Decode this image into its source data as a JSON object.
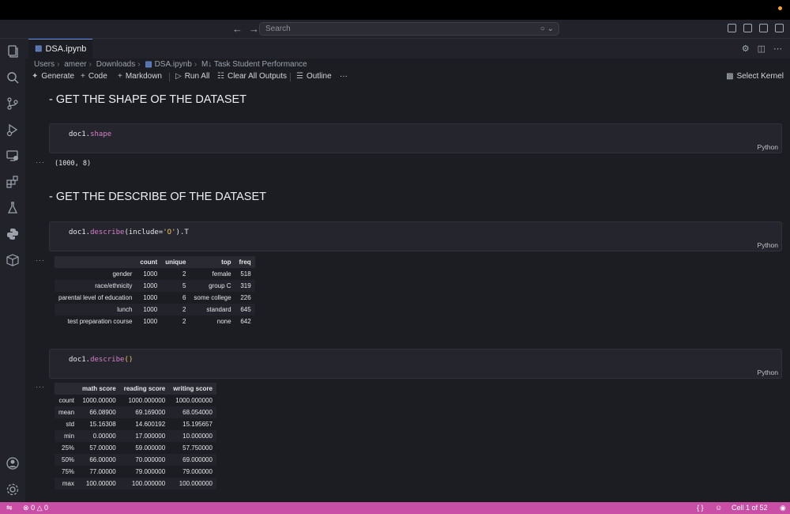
{
  "search": {
    "placeholder": "Search"
  },
  "tab": {
    "filename": "DSA.ipynb"
  },
  "breadcrumb": {
    "items": [
      "Users",
      "ameer",
      "Downloads",
      "DSA.ipynb",
      "Task Student Performance"
    ]
  },
  "toolbar": {
    "generate": "Generate",
    "code": "Code",
    "markdown": "Markdown",
    "run_all": "Run All",
    "clear_outputs": "Clear All Outputs",
    "outline": "Outline",
    "more": "···",
    "select_kernel": "Select Kernel"
  },
  "cells": {
    "heading1": "- GET THE SHAPE OF THE DATASET",
    "code1": {
      "obj": "doc1.",
      "attr": "shape",
      "lang": "Python"
    },
    "output1": "(1000, 8)",
    "heading2": "- GET THE DESCRIBE OF THE DATASET",
    "code2": {
      "obj": "doc1.",
      "attr": "describe",
      "open": "(include=",
      "arg": "'O'",
      "close": ").T",
      "lang": "Python"
    },
    "table1": {
      "columns": [
        "",
        "count",
        "unique",
        "top",
        "freq"
      ],
      "rows": [
        [
          "gender",
          "1000",
          "2",
          "female",
          "518"
        ],
        [
          "race/ethnicity",
          "1000",
          "5",
          "group C",
          "319"
        ],
        [
          "parental level of education",
          "1000",
          "6",
          "some college",
          "226"
        ],
        [
          "lunch",
          "1000",
          "2",
          "standard",
          "645"
        ],
        [
          "test preparation course",
          "1000",
          "2",
          "none",
          "642"
        ]
      ]
    },
    "code3": {
      "obj": "doc1.",
      "attr": "describe",
      "close": "()",
      "lang": "Python"
    },
    "table2": {
      "columns": [
        "",
        "math score",
        "reading score",
        "writing score"
      ],
      "rows": [
        [
          "count",
          "1000.00000",
          "1000.000000",
          "1000.000000"
        ],
        [
          "mean",
          "66.08900",
          "69.169000",
          "68.054000"
        ],
        [
          "std",
          "15.16308",
          "14.600192",
          "15.195657"
        ],
        [
          "min",
          "0.00000",
          "17.000000",
          "10.000000"
        ],
        [
          "25%",
          "57.00000",
          "59.000000",
          "57.750000"
        ],
        [
          "50%",
          "66.00000",
          "70.000000",
          "69.000000"
        ],
        [
          "75%",
          "77.00000",
          "79.000000",
          "79.000000"
        ],
        [
          "max",
          "100.00000",
          "100.000000",
          "100.000000"
        ]
      ]
    },
    "output_dots": "···"
  },
  "status": {
    "errors": "0",
    "warnings": "0",
    "braces": "{ }",
    "cell_position": "Cell 1 of 52"
  },
  "colors": {
    "statusbar": "#c94fa6",
    "accent": "#5b8def"
  }
}
